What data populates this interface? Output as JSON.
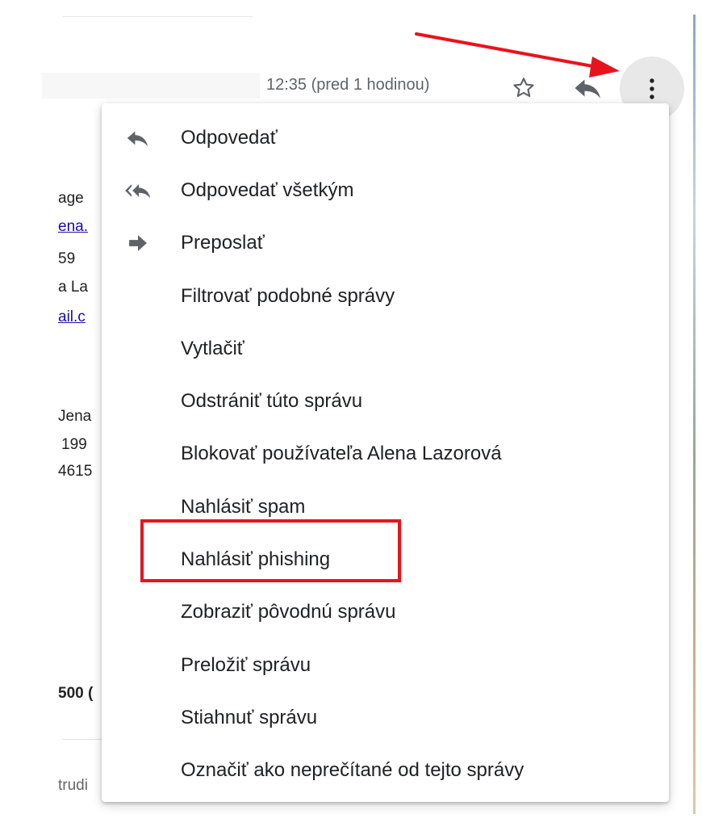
{
  "header": {
    "timestamp": "12:35 (pred 1 hodinou)",
    "icons": {
      "star": "star-icon",
      "reply": "reply-icon",
      "more": "more-vert-icon"
    }
  },
  "background_fragments": {
    "line1": "age",
    "line2": "ena.",
    "line3": "59",
    "line4": "a La",
    "line5": "ail.c",
    "line6": "Jena",
    "line7": "199",
    "line8": "4615",
    "line9": "500 (",
    "line10": "trudi"
  },
  "menu": {
    "items": [
      {
        "label": "Odpovedať",
        "icon": "reply-icon"
      },
      {
        "label": "Odpovedať všetkým",
        "icon": "reply-all-icon"
      },
      {
        "label": "Preposlať",
        "icon": "forward-icon"
      },
      {
        "label": "Filtrovať podobné správy",
        "icon": ""
      },
      {
        "label": "Vytlačiť",
        "icon": ""
      },
      {
        "label": "Odstrániť túto správu",
        "icon": ""
      },
      {
        "label": "Blokovať používateľa Alena Lazorová",
        "icon": ""
      },
      {
        "label": "Nahlásiť spam",
        "icon": ""
      },
      {
        "label": "Nahlásiť phishing",
        "icon": ""
      },
      {
        "label": "Zobraziť pôvodnú správu",
        "icon": ""
      },
      {
        "label": "Preložiť správu",
        "icon": ""
      },
      {
        "label": "Stiahnuť správu",
        "icon": ""
      },
      {
        "label": "Označiť ako neprečítané od tejto správy",
        "icon": ""
      }
    ]
  },
  "colors": {
    "annotation_red": "#e8141c",
    "icon_gray": "#5f6368",
    "text_dark": "#202124"
  }
}
